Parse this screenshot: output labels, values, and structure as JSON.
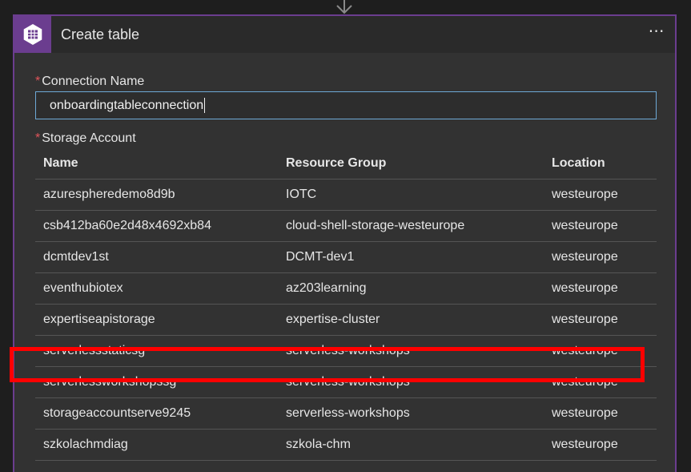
{
  "card": {
    "title": "Create table",
    "more_label": "⋯"
  },
  "connection": {
    "label": "Connection Name",
    "value": "onboardingtableconnection"
  },
  "storage": {
    "label": "Storage Account",
    "columns": [
      "Name",
      "Resource Group",
      "Location"
    ],
    "rows": [
      {
        "name": "azurespheredemo8d9b",
        "group": "IOTC",
        "location": "westeurope"
      },
      {
        "name": "csb412ba60e2d48x4692xb84",
        "group": "cloud-shell-storage-westeurope",
        "location": "westeurope"
      },
      {
        "name": "dcmtdev1st",
        "group": "DCMT-dev1",
        "location": "westeurope"
      },
      {
        "name": "eventhubiotex",
        "group": "az203learning",
        "location": "westeurope"
      },
      {
        "name": "expertiseapistorage",
        "group": "expertise-cluster",
        "location": "westeurope"
      },
      {
        "name": "serverlessstaticsg",
        "group": "serverless-workshops",
        "location": "westeurope"
      },
      {
        "name": "serverlessworkshopssg",
        "group": "serverless-workshops",
        "location": "westeurope"
      },
      {
        "name": "storageaccountserve9245",
        "group": "serverless-workshops",
        "location": "westeurope"
      },
      {
        "name": "szkolachmdiag",
        "group": "szkola-chm",
        "location": "westeurope"
      }
    ]
  },
  "colors": {
    "accent": "#6b3d8f",
    "highlight": "#ff0000",
    "input_border": "#6ea9d6",
    "required": "#e0545a"
  }
}
